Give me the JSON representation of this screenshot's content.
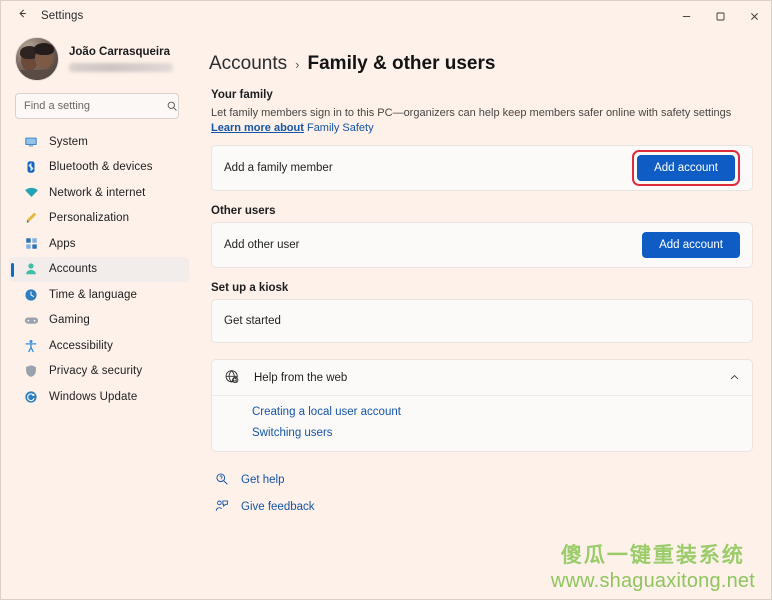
{
  "titlebar": {
    "back_icon": "arrow-left-icon",
    "title": "Settings",
    "minimize_label": "minimize-icon",
    "maximize_label": "maximize-icon",
    "close_label": "close-icon"
  },
  "sidebar": {
    "profile": {
      "name": "João Carrasqueira",
      "email_redacted": true
    },
    "search": {
      "placeholder": "Find a setting",
      "value": "",
      "icon": "search-icon"
    },
    "items": [
      {
        "label": "System",
        "icon": "monitor-icon",
        "selected": false
      },
      {
        "label": "Bluetooth & devices",
        "icon": "bluetooth-icon",
        "selected": false
      },
      {
        "label": "Network & internet",
        "icon": "wifi-icon",
        "selected": false
      },
      {
        "label": "Personalization",
        "icon": "paintbrush-icon",
        "selected": false
      },
      {
        "label": "Apps",
        "icon": "apps-grid-icon",
        "selected": false
      },
      {
        "label": "Accounts",
        "icon": "person-icon",
        "selected": true
      },
      {
        "label": "Time & language",
        "icon": "clock-icon",
        "selected": false
      },
      {
        "label": "Gaming",
        "icon": "gamepad-icon",
        "selected": false
      },
      {
        "label": "Accessibility",
        "icon": "accessibility-icon",
        "selected": false
      },
      {
        "label": "Privacy & security",
        "icon": "shield-icon",
        "selected": false
      },
      {
        "label": "Windows Update",
        "icon": "update-icon",
        "selected": false
      }
    ]
  },
  "content": {
    "breadcrumb": {
      "parent": "Accounts",
      "separator": "›",
      "current": "Family & other users"
    },
    "your_family": {
      "heading": "Your family",
      "description": "Let family members sign in to this PC—organizers can help keep members safer online with safety settings",
      "link_bold": "Learn more about",
      "link_rest": "Family Safety",
      "row_label": "Add a family member",
      "button_label": "Add account",
      "button_highlighted": true,
      "highlight_color": "#e02b3c"
    },
    "other_users": {
      "heading": "Other users",
      "row_label": "Add other user",
      "button_label": "Add account"
    },
    "kiosk": {
      "heading": "Set up a kiosk",
      "row_label": "Get started"
    },
    "help": {
      "icon": "globe-help-icon",
      "title": "Help from the web",
      "chevron": "chevron-up-icon",
      "expanded": true,
      "links": [
        "Creating a local user account",
        "Switching users"
      ]
    },
    "footer": [
      {
        "label": "Get help",
        "icon": "get-help-icon"
      },
      {
        "label": "Give feedback",
        "icon": "feedback-icon"
      }
    ]
  },
  "watermark": {
    "line1": "傻瓜一键重装系统",
    "line2": "www.shaguaxitong.net",
    "color": "#9ccb6a"
  }
}
